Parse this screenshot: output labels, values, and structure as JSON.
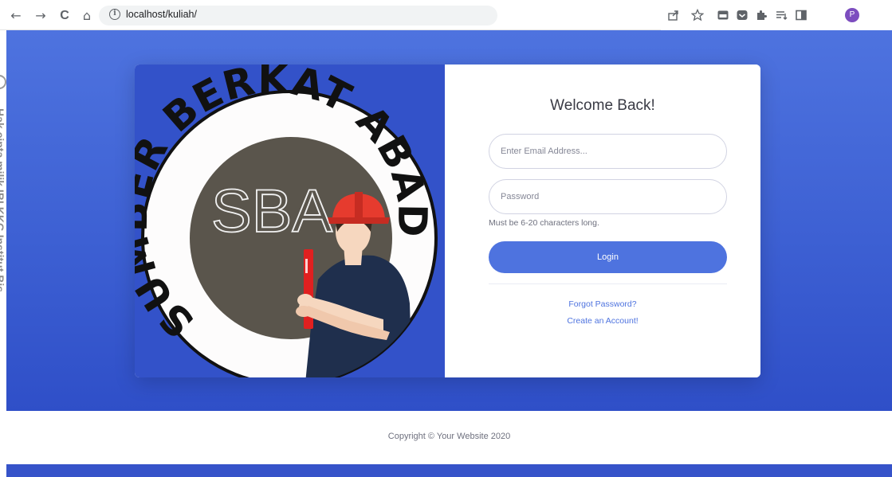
{
  "browser": {
    "url": "localhost/kuliah/",
    "back_label": "←",
    "forward_label": "→",
    "reload_label": "C",
    "home_label": "⌂",
    "info_label": "i",
    "profile_initial": "P",
    "menu_label": "⋮"
  },
  "logo": {
    "arc_text": "SUMBER BERKAT ABADI",
    "monogram": "SBA"
  },
  "login": {
    "title": "Welcome Back!",
    "email_placeholder": "Enter Email Address...",
    "password_placeholder": "Password",
    "password_hint": "Must be 6-20 characters long.",
    "login_label": "Login",
    "forgot_label": "Forgot Password?",
    "create_label": "Create an Account!"
  },
  "footer": {
    "copyright": "Copyright © Your Website 2020"
  },
  "watermark": {
    "text": "Hak cipta milik IBI KKG Institut Bis"
  },
  "colors": {
    "primary": "#4e73df",
    "card_left": "#3352c9",
    "logo_fill": "#5a554c",
    "helmet_red": "#e63b2e",
    "shirt_navy": "#1f2f4d"
  },
  "icons": [
    "back-arrow-icon",
    "forward-arrow-icon",
    "reload-icon",
    "home-icon",
    "info-icon",
    "share-icon",
    "star-icon",
    "extension-icon",
    "puzzle-icon",
    "reading-list-icon",
    "side-panel-icon",
    "kebab-menu-icon"
  ]
}
